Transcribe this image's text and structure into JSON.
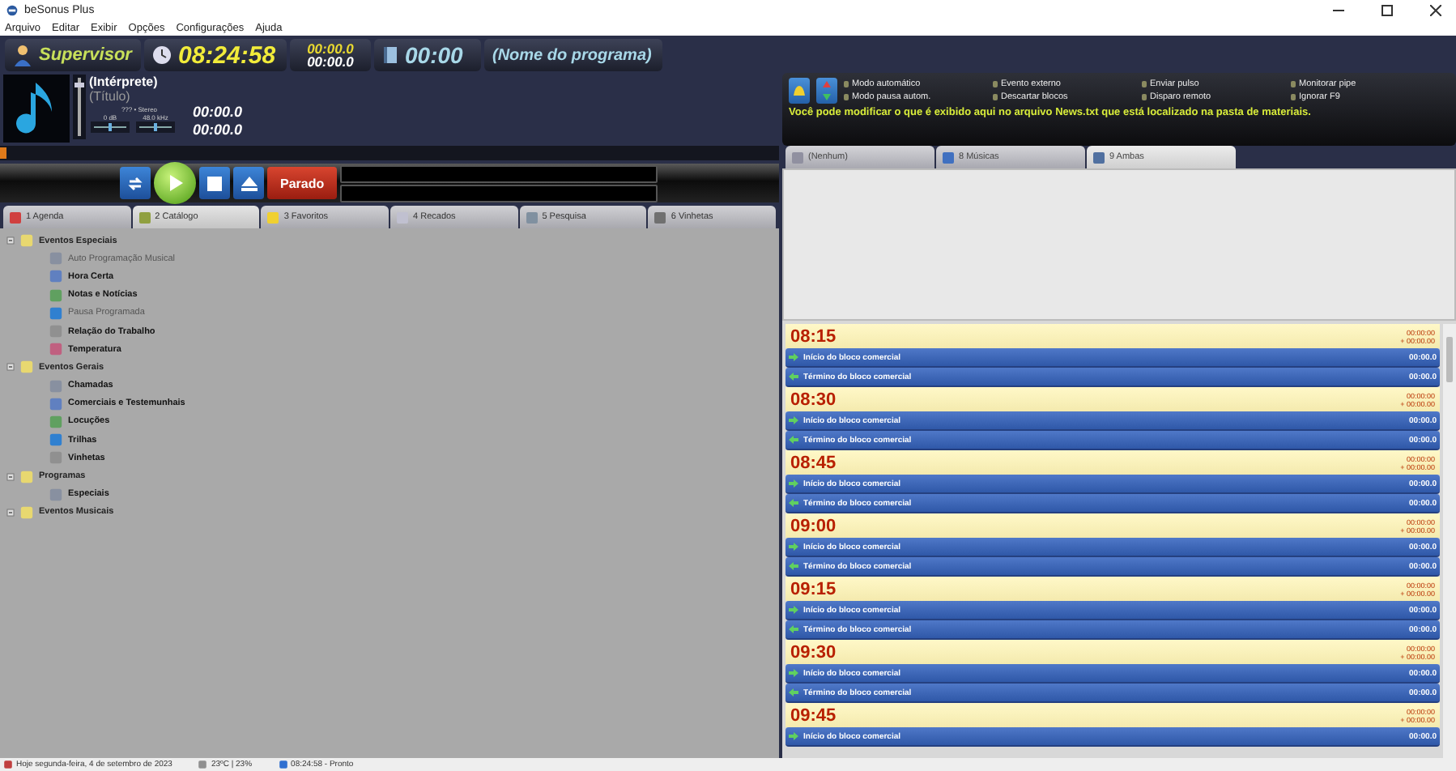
{
  "window": {
    "title": "beSonus Plus"
  },
  "menu": [
    "Arquivo",
    "Editar",
    "Exibir",
    "Opções",
    "Configurações",
    "Ajuda"
  ],
  "header": {
    "user": "Supervisor",
    "clock": "08:24:58",
    "counter_top": "00:00.0",
    "counter_bottom": "00:00.0",
    "program_time": "00:00",
    "program_name": "(Nome do programa)"
  },
  "player": {
    "artist": "(Intérprete)",
    "title": "(Título)",
    "format": "??? • Stereo",
    "volume": {
      "level": 0.9
    },
    "gain": {
      "label": "0 dB",
      "level": 0.5
    },
    "rate": {
      "label": "48.0 kHz",
      "level": 0.5
    },
    "elapsed": "00:00.0",
    "remaining": "00:00.0",
    "position": {
      "level": 0
    }
  },
  "transport": {
    "status": "Parado"
  },
  "left_tabs": [
    {
      "label": "1 Agenda",
      "selected": false
    },
    {
      "label": "2 Catálogo",
      "selected": true
    },
    {
      "label": "3 Favoritos",
      "selected": false
    },
    {
      "label": "4 Recados",
      "selected": false
    },
    {
      "label": "5 Pesquisa",
      "selected": false
    },
    {
      "label": "6 Vinhetas",
      "selected": false
    }
  ],
  "tree": [
    {
      "label": "Eventos Especiais",
      "expanded": true,
      "children": [
        {
          "label": "Auto Programação Musical",
          "disabled": true
        },
        {
          "label": "Hora Certa",
          "disabled": false
        },
        {
          "label": "Notas e Notícias",
          "disabled": false
        },
        {
          "label": "Pausa Programada",
          "disabled": true
        },
        {
          "label": "Relação do Trabalho",
          "disabled": false
        },
        {
          "label": "Temperatura",
          "disabled": false
        }
      ]
    },
    {
      "label": "Eventos Gerais",
      "expanded": true,
      "children": [
        {
          "label": "Chamadas",
          "disabled": false
        },
        {
          "label": "Comerciais e Testemunhais",
          "disabled": false
        },
        {
          "label": "Locuções",
          "disabled": false
        },
        {
          "label": "Trilhas",
          "disabled": false
        },
        {
          "label": "Vinhetas",
          "disabled": false
        }
      ]
    },
    {
      "label": "Programas",
      "expanded": true,
      "children": [
        {
          "label": "Especiais",
          "disabled": false
        }
      ]
    },
    {
      "label": "Eventos Musicais",
      "expanded": true
    }
  ],
  "indicators": [
    {
      "label": "Modo automático",
      "on": false
    },
    {
      "label": "Modo pausa autom.",
      "on": false
    },
    {
      "label": "Evento externo",
      "on": false
    },
    {
      "label": "Descartar blocos",
      "on": false
    },
    {
      "label": "Enviar pulso",
      "on": false
    },
    {
      "label": "Disparo remoto",
      "on": false
    },
    {
      "label": "Monitorar pipe",
      "on": false
    },
    {
      "label": "Ignorar F9",
      "on": false
    }
  ],
  "news": "Você pode modificar o que é exibido aqui no arquivo News.txt que está localizado na pasta de materiais.",
  "right_tabs": [
    {
      "label": "(Nenhum)",
      "selected": false
    },
    {
      "label": "8 Músicas",
      "selected": false
    },
    {
      "label": "9 Ambas",
      "selected": true
    }
  ],
  "schedule": [
    {
      "time": "08:15",
      "planned": "00:00:00",
      "offset": "+ 00:00.00",
      "items": [
        {
          "kind": "start",
          "label": "Início do bloco comercial",
          "duration": "00:00.0"
        },
        {
          "kind": "end",
          "label": "Término do bloco comercial",
          "duration": "00:00.0"
        }
      ]
    },
    {
      "time": "08:30",
      "planned": "00:00:00",
      "offset": "+ 00:00.00",
      "items": [
        {
          "kind": "start",
          "label": "Início do bloco comercial",
          "duration": "00:00.0"
        },
        {
          "kind": "end",
          "label": "Término do bloco comercial",
          "duration": "00:00.0"
        }
      ]
    },
    {
      "time": "08:45",
      "planned": "00:00:00",
      "offset": "+ 00:00.00",
      "items": [
        {
          "kind": "start",
          "label": "Início do bloco comercial",
          "duration": "00:00.0"
        },
        {
          "kind": "end",
          "label": "Término do bloco comercial",
          "duration": "00:00.0"
        }
      ]
    },
    {
      "time": "09:00",
      "planned": "00:00:00",
      "offset": "+ 00:00.00",
      "items": [
        {
          "kind": "start",
          "label": "Início do bloco comercial",
          "duration": "00:00.0"
        },
        {
          "kind": "end",
          "label": "Término do bloco comercial",
          "duration": "00:00.0"
        }
      ]
    },
    {
      "time": "09:15",
      "planned": "00:00:00",
      "offset": "+ 00:00.00",
      "items": [
        {
          "kind": "start",
          "label": "Início do bloco comercial",
          "duration": "00:00.0"
        },
        {
          "kind": "end",
          "label": "Término do bloco comercial",
          "duration": "00:00.0"
        }
      ]
    },
    {
      "time": "09:30",
      "planned": "00:00:00",
      "offset": "+ 00:00.00",
      "items": [
        {
          "kind": "start",
          "label": "Início do bloco comercial",
          "duration": "00:00.0"
        },
        {
          "kind": "end",
          "label": "Término do bloco comercial",
          "duration": "00:00.0"
        }
      ]
    },
    {
      "time": "09:45",
      "planned": "00:00:00",
      "offset": "+ 00:00.00",
      "items": [
        {
          "kind": "start",
          "label": "Início do bloco comercial",
          "duration": "00:00.0"
        }
      ]
    }
  ],
  "status_bar": {
    "date": "Hoje segunda-feira, 4 de setembro de 2023",
    "weather": "23ºC | 23%",
    "state": "08:24:58 - Pronto"
  }
}
